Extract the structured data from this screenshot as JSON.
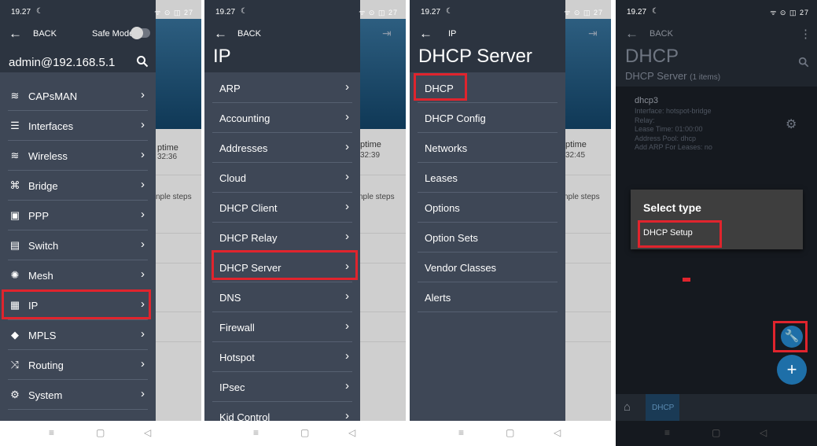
{
  "status": {
    "time": "19.27",
    "icons": "ᯤ ⊙ ◫ 27"
  },
  "panel1": {
    "back_label": "BACK",
    "safe_mode_label": "Safe Mode",
    "account": "admin@192.168.5.1",
    "menu": [
      {
        "label": "CAPsMAN",
        "icon": "wifi-icon"
      },
      {
        "label": "Interfaces",
        "icon": "interfaces-icon"
      },
      {
        "label": "Wireless",
        "icon": "wifi-icon"
      },
      {
        "label": "Bridge",
        "icon": "bridge-icon"
      },
      {
        "label": "PPP",
        "icon": "ppp-icon"
      },
      {
        "label": "Switch",
        "icon": "switch-icon"
      },
      {
        "label": "Mesh",
        "icon": "mesh-icon"
      },
      {
        "label": "IP",
        "icon": "ip-icon"
      },
      {
        "label": "MPLS",
        "icon": "tag-icon"
      },
      {
        "label": "Routing",
        "icon": "routing-icon"
      },
      {
        "label": "System",
        "icon": "gear-icon"
      }
    ],
    "bg_text": {
      "uptime": "ptime",
      "uptime_value": "32:36",
      "steps": "nple steps"
    }
  },
  "panel2": {
    "back_label": "BACK",
    "title": "IP",
    "menu": [
      "ARP",
      "Accounting",
      "Addresses",
      "Cloud",
      "DHCP Client",
      "DHCP Relay",
      "DHCP Server",
      "DNS",
      "Firewall",
      "Hotspot",
      "IPsec",
      "Kid Control"
    ],
    "bg_text": {
      "uptime": "ptime",
      "uptime_value": "32:39",
      "steps": "nple steps"
    }
  },
  "panel3": {
    "back_label": "IP",
    "title": "DHCP Server",
    "menu": [
      "DHCP",
      "DHCP Config",
      "Networks",
      "Leases",
      "Options",
      "Option Sets",
      "Vendor Classes",
      "Alerts"
    ],
    "bg_text": {
      "uptime": "ptime",
      "uptime_value": "32:45",
      "steps": "nple steps"
    }
  },
  "panel4": {
    "back_label": "BACK",
    "title": "DHCP",
    "subtitle": "DHCP Server",
    "count": "(1 items)",
    "item": {
      "name": "dhcp3",
      "lines": [
        "Interface: hotspot-bridge",
        "Relay:",
        "Lease Time: 01:00:00",
        "Address Pool: dhcp",
        "Add ARP For Leases: no"
      ]
    },
    "dialog": {
      "title": "Select type",
      "option": "DHCP Setup"
    },
    "tab_label": "DHCP",
    "colors": {
      "highlight": "#e0242d",
      "fab": "#1e6fa8"
    }
  }
}
